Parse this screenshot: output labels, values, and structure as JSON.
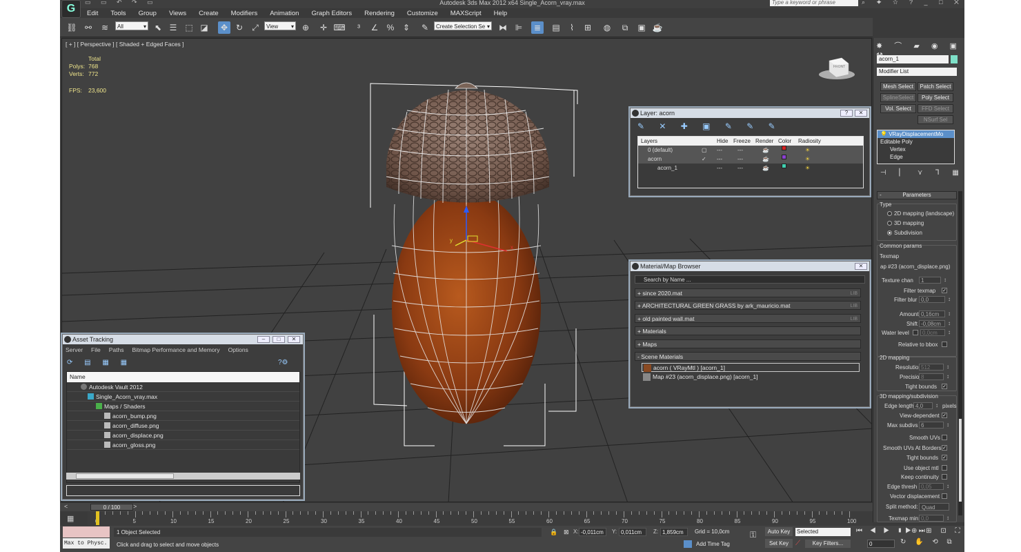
{
  "window": {
    "title": "Autodesk 3ds Max  2012 x64      Single_Acorn_vray.max",
    "search_placeholder": "Type a keyword or phrase"
  },
  "menu": [
    "Edit",
    "Tools",
    "Group",
    "Views",
    "Create",
    "Modifiers",
    "Animation",
    "Graph Editors",
    "Rendering",
    "Customize",
    "MAXScript",
    "Help"
  ],
  "toolbar": {
    "selection_filter": "All",
    "ref_coord": "View",
    "named_selection": "Create Selection Se"
  },
  "viewport": {
    "label": "[ + ] [ Perspective ] [ Shaded + Edged Faces ]",
    "stats_header": "Total",
    "polys_label": "Polys:",
    "polys_value": "768",
    "verts_label": "Verts:",
    "verts_value": "772",
    "fps_label": "FPS:",
    "fps_value": "23,600",
    "viewcube_label": "FRONT"
  },
  "layer_window": {
    "title": "Layer: acorn",
    "columns": [
      "Layers",
      "Hide",
      "Freeze",
      "Render",
      "Color",
      "Radiosity"
    ],
    "rows": [
      {
        "name": "0 (default)",
        "color": "#d42020"
      },
      {
        "name": "acorn",
        "color": "#8a40d0"
      },
      {
        "name": "acorn_1",
        "color": "#40d0b0"
      }
    ]
  },
  "material_browser": {
    "title": "Material/Map Browser",
    "search_placeholder": "Search by Name ...",
    "groups": [
      "+ since 2020.mat",
      "+ ARCHITECTURAL GREEN GRASS by ark_mauricio.mat",
      "+ old painted wall.mat",
      "+ Materials",
      "+ Maps",
      "- Scene Materials"
    ],
    "lib_tag": "LIB",
    "entries": [
      "acorn  ( VRayMtl )  [acorn_1]",
      "Map #23 (acorn_displace.png)  [acorn_1]"
    ]
  },
  "asset_tracking": {
    "title": "Asset Tracking",
    "menu": [
      "Server",
      "File",
      "Paths",
      "Bitmap Performance and Memory",
      "Options"
    ],
    "column": "Name",
    "rows": [
      "Autodesk Vault 2012",
      "Single_Acorn_vray.max",
      "Maps / Shaders",
      "acorn_bump.png",
      "acorn_diffuse.png",
      "acorn_displace.png",
      "acorn_gloss.png"
    ]
  },
  "command_panel": {
    "object_name": "acorn_1",
    "object_color": "#7ee0c8",
    "modifier_list": "Modifier List",
    "buttons": [
      "Mesh Select",
      "Patch Select",
      "SplineSelect",
      "Poly Select",
      "Vol. Select",
      "FFD Select",
      "NSurf Sel"
    ],
    "stack": [
      "VRayDisplacementMo",
      "Editable Poly",
      "Vertex",
      "Edge"
    ],
    "rollout": "Parameters",
    "type_label": "Type",
    "type_options": [
      "2D mapping (landscape)",
      "3D mapping",
      "Subdivision"
    ],
    "common_label": "Common params",
    "texmap_label": "Texmap",
    "texmap_value": "ap #23 (acorn_displace.png)",
    "texture_chan_label": "Texture chan",
    "texture_chan_value": "1",
    "filter_texmap_label": "Filter texmap",
    "filter_blur_label": "Filter blur",
    "filter_blur_value": "0,0",
    "amount_label": "Amount",
    "amount_value": "0,16cm",
    "shift_label": "Shift",
    "shift_value": "-0,08cm",
    "water_label": "Water level",
    "water_value": "0,0cm",
    "relative_label": "Relative to bbox",
    "map2d_label": "2D mapping",
    "resolution_label": "Resolution",
    "resolution_value": "512",
    "precision_label": "Precision",
    "precision_value": "8",
    "tight_label": "Tight bounds",
    "map3d_label": "3D mapping/subdivision",
    "edge_length_label": "Edge length",
    "edge_length_value": "4,0",
    "pixels_label": "pixels",
    "view_dep_label": "View-dependent",
    "max_subdivs_label": "Max subdivs",
    "max_subdivs_value": "6",
    "smooth_uvs_label": "Smooth UVs",
    "smooth_uvs_borders_label": "Smooth UVs At Borders",
    "tight2_label": "Tight bounds",
    "use_obj_mtl_label": "Use object mtl",
    "keep_cont_label": "Keep continuity",
    "edge_thresh_label": "Edge thresh",
    "edge_thresh_value": "0,05",
    "vector_disp_label": "Vector displacement",
    "split_label": "Split method:",
    "split_value": "Quad",
    "texmap_min_label": "Texmap min:",
    "texmap_min_value": "0,0"
  },
  "timeline": {
    "frame": "0 / 100",
    "ticks": [
      "0",
      "5",
      "10",
      "15",
      "20",
      "25",
      "30",
      "35",
      "40",
      "45",
      "50",
      "55",
      "60",
      "65",
      "70",
      "75",
      "80",
      "85",
      "90",
      "95",
      "100"
    ]
  },
  "status": {
    "maxscript": "Max to Physc.",
    "objects": "1 Object Selected",
    "prompt": "Click and drag to select and move objects",
    "x_label": "X:",
    "x_value": "-0,011cm",
    "y_label": "Y:",
    "y_value": "0,011cm",
    "z_label": "Z:",
    "z_value": "1,859cm",
    "grid": "Grid = 10,0cm",
    "add_time_tag": "Add Time Tag",
    "auto_key": "Auto Key",
    "set_key": "Set Key",
    "selected": "Selected",
    "key_filters": "Key Filters...",
    "frame_value": "0"
  }
}
